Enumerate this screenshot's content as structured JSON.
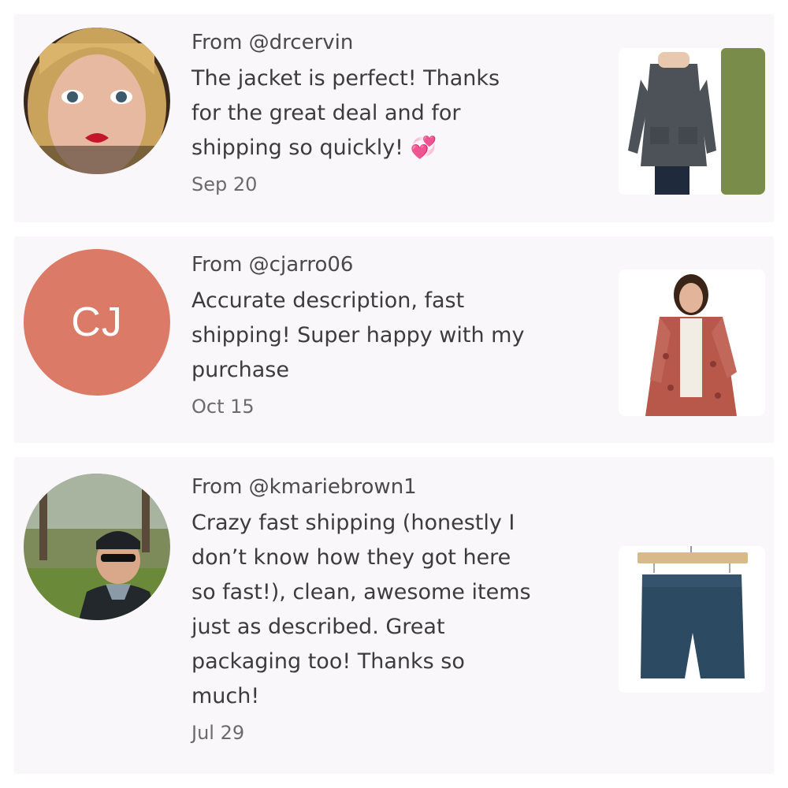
{
  "reviews": [
    {
      "from": "From @drcervin",
      "text": "The jacket is perfect! Thanks\nfor the great deal and for\nshipping so quickly! 💞",
      "date": "Sep 20",
      "avatar_icon": "photo-avatar-woman-blonde",
      "product_icon": "grey-utility-jacket-photo"
    },
    {
      "from": "From @cjarro06",
      "text": "Accurate description, fast\nshipping! Super happy with my\npurchase",
      "date": "Oct 15",
      "initials": "CJ",
      "avatar_color": "#db7a66",
      "product_icon": "floral-quilted-jacket-photo"
    },
    {
      "from": "From @kmariebrown1",
      "text": "Crazy fast shipping (honestly I\ndon’t know how they got here\nso fast!), clean, awesome items\njust as described. Great\npackaging too! Thanks so\nmuch!",
      "date": "Jul 29",
      "avatar_icon": "photo-avatar-woman-outdoors",
      "product_icon": "navy-shorts-on-hanger-photo"
    }
  ]
}
